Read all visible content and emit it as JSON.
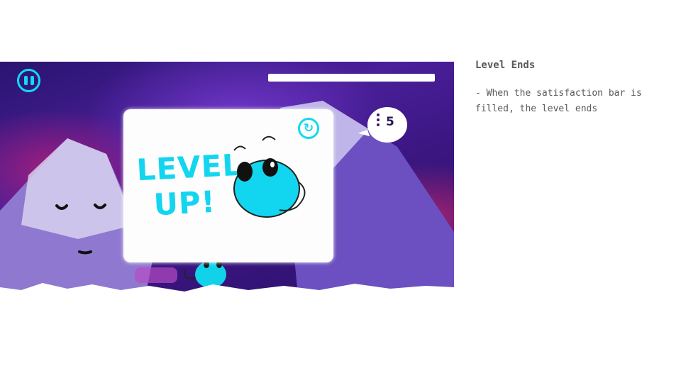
{
  "game": {
    "hud": {
      "pause_icon": "pause-icon",
      "satisfaction_bar_fill_percent": 100,
      "speech_bubble": {
        "icon": "three-dots-icon",
        "count": "5"
      }
    },
    "card": {
      "title": "LEVEL UP!",
      "restart_icon": "restart-icon",
      "restart_glyph": "↻"
    },
    "colors": {
      "accent": "#13d9f2",
      "sky": "#3a1680",
      "mountain": "#7c5ac8",
      "snow": "#ffffff"
    }
  },
  "notes": {
    "title": "Level Ends",
    "body": "- When the satisfaction bar is filled, the level ends"
  }
}
